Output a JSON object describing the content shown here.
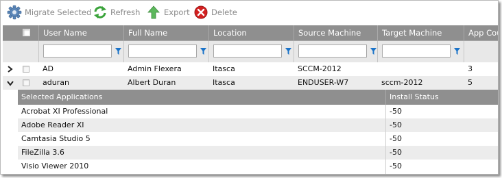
{
  "toolbar": {
    "migrate_label": "Migrate Selected",
    "refresh_label": "Refresh",
    "export_label": "Export",
    "delete_label": "Delete"
  },
  "grid": {
    "columns": [
      {
        "label": "User Name"
      },
      {
        "label": "Full Name"
      },
      {
        "label": "Location"
      },
      {
        "label": "Source Machine"
      },
      {
        "label": "Target Machine"
      },
      {
        "label": "App Cou"
      }
    ],
    "rows": [
      {
        "user": "AD",
        "full_name": "Admin Flexera",
        "location": "Itasca",
        "source": "SCCM-2012",
        "target": "",
        "app_count": "3",
        "expanded": false
      },
      {
        "user": "aduran",
        "full_name": "Albert Duran",
        "location": "Itasca",
        "source": "ENDUSER-W7",
        "target": "sccm-2012",
        "app_count": "5",
        "expanded": true
      }
    ]
  },
  "detail": {
    "headers": {
      "apps": "Selected Applications",
      "status": "Install Status"
    },
    "rows": [
      {
        "app": "Acrobat XI Professional",
        "status": "-50"
      },
      {
        "app": "Adobe Reader XI",
        "status": "-50"
      },
      {
        "app": "Camtasia Studio 5",
        "status": "-50"
      },
      {
        "app": "FileZilla 3.6",
        "status": "-50"
      },
      {
        "app": "Visio Viewer 2010",
        "status": "-50"
      }
    ]
  },
  "colors": {
    "header_bg": "#8f8f8f",
    "filter_bg": "#e8e8e8",
    "alt_row_bg": "#ececec",
    "filter_icon": "#1a73c9",
    "delete_red": "#d32020",
    "refresh_green": "#3aa33a",
    "export_green": "#4aa84a",
    "migrate_blue": "#4f7fb3"
  },
  "icons": {
    "migrate": "gear-icon",
    "refresh": "refresh-arrows-icon",
    "export": "up-arrow-icon",
    "delete": "red-x-circle-icon",
    "filter": "funnel-icon",
    "collapsed": "chevron-right-icon",
    "expanded": "chevron-down-icon"
  }
}
